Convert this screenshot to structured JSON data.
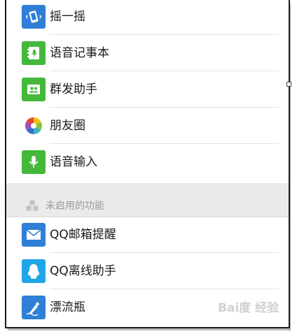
{
  "enabled_features": [
    {
      "label": "摇一摇",
      "icon": "shake-phone-icon",
      "color": "#2f7fd6"
    },
    {
      "label": "语音记事本",
      "icon": "voice-notebook-icon",
      "color": "#44b83a"
    },
    {
      "label": "群发助手",
      "icon": "broadcast-contacts-icon",
      "color": "#44b83a"
    },
    {
      "label": "朋友圈",
      "icon": "moments-aperture-icon",
      "color": "#ffffff"
    },
    {
      "label": "语音输入",
      "icon": "microphone-icon",
      "color": "#44b83a"
    }
  ],
  "disabled_section": {
    "label": "未启用的功能",
    "icon": "grey-circles-icon"
  },
  "disabled_features": [
    {
      "label": "QQ邮箱提醒",
      "icon": "mail-envelope-icon",
      "color": "#2f7fd6"
    },
    {
      "label": "QQ离线助手",
      "icon": "qq-penguin-icon",
      "color": "#1fa6e8"
    },
    {
      "label": "漂流瓶",
      "icon": "drift-bottle-icon",
      "color": "#2f7fd6"
    }
  ],
  "watermark": "Bai度 经验"
}
